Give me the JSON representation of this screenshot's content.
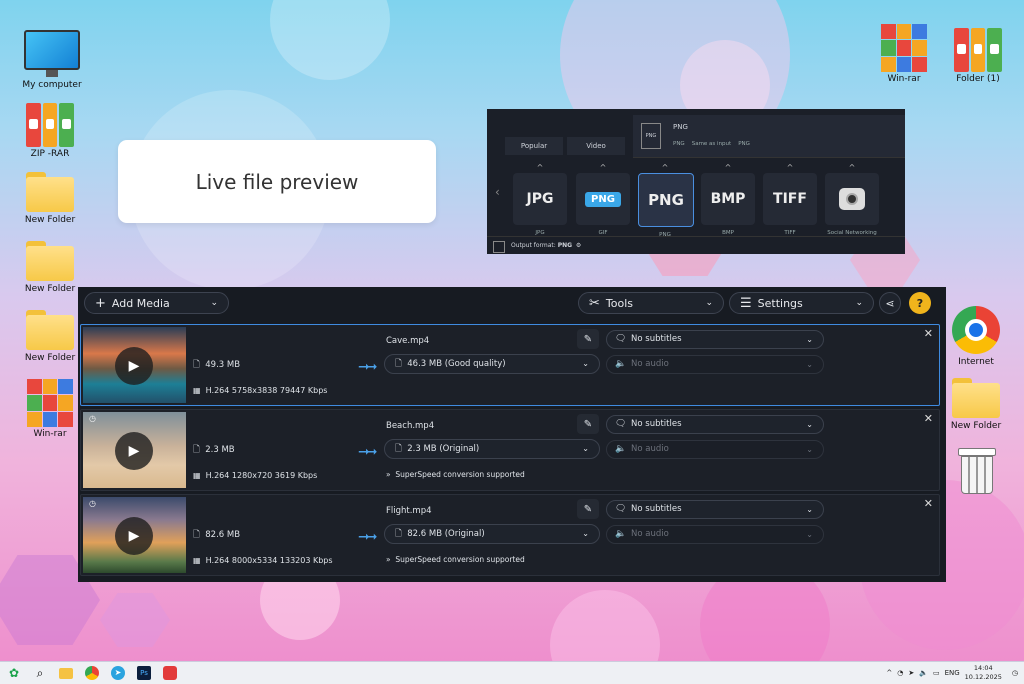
{
  "desktop": {
    "icons_left": [
      "My computer",
      "ZIP -RAR",
      "New Folder",
      "New Folder",
      "New Folder",
      "Win-rar"
    ],
    "icons_top_right": [
      "Win-rar",
      "Folder (1)"
    ],
    "icons_right": [
      "Internet",
      "New Folder"
    ]
  },
  "preview_card": {
    "text": "Live file preview"
  },
  "format_panel": {
    "tabs": [
      "Popular",
      "Video"
    ],
    "tooltip": {
      "icon": "PNG",
      "title": "PNG",
      "line1": "PNG",
      "line2": "Same as input",
      "line3": "PNG"
    },
    "formats": [
      {
        "big": "JPG",
        "caption": "JPG"
      },
      {
        "big": "PNG",
        "caption": "GIF"
      },
      {
        "big": "PNG",
        "caption": "PNG"
      },
      {
        "big": "BMP",
        "caption": "BMP"
      },
      {
        "big": "TIFF",
        "caption": "TIFF"
      },
      {
        "big": "",
        "caption": "Social Networking"
      }
    ],
    "footer_label": "Output format:",
    "footer_value": "PNG"
  },
  "toolbar": {
    "add_media": "Add Media",
    "tools": "Tools",
    "settings": "Settings",
    "help": "?"
  },
  "files": [
    {
      "name": "Cave.mp4",
      "size": "49.3 MB",
      "codec": "H.264 5758x3838 79447 Kbps",
      "output": "46.3 MB (Good quality)",
      "subtitles": "No subtitles",
      "audio": "No audio",
      "extra": ""
    },
    {
      "name": "Beach.mp4",
      "size": "2.3 MB",
      "codec": "H.264 1280x720 3619 Kbps",
      "output": "2.3 MB (Original)",
      "subtitles": "No subtitles",
      "audio": "No audio",
      "extra": "SuperSpeed conversion supported"
    },
    {
      "name": "Flight.mp4",
      "size": "82.6 MB",
      "codec": "H.264 8000x5334 133203 Kbps",
      "output": "82.6 MB (Original)",
      "subtitles": "No subtitles",
      "audio": "No audio",
      "extra": "SuperSpeed conversion supported"
    }
  ],
  "taskbar": {
    "lang": "ENG",
    "time": "14:04",
    "date": "10.12.2025"
  }
}
